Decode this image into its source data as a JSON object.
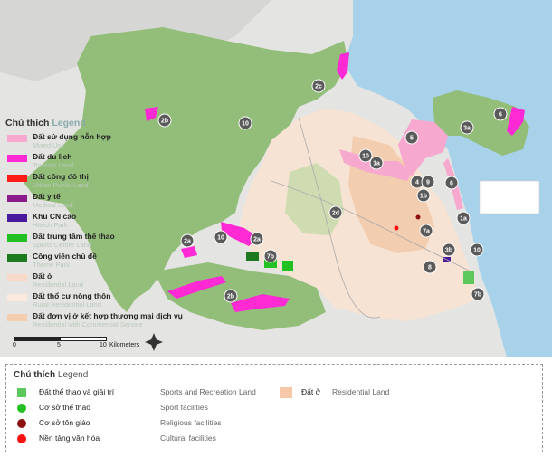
{
  "legend": {
    "title_vi": "Chú thích",
    "title_en": "Legend",
    "items": [
      {
        "vi": "Đất sử dụng hỗn hợp",
        "en": "Mixed Use",
        "color": "#f7a8cf"
      },
      {
        "vi": "Đất du lịch",
        "en": "Tourism Land",
        "color": "#ff2ad4"
      },
      {
        "vi": "Đất công đô thị",
        "en": "Urban Public Land",
        "color": "#ff1a1a"
      },
      {
        "vi": "Đất y tế",
        "en": "Medical Land",
        "color": "#8b1a8b"
      },
      {
        "vi": "Khu CN cao",
        "en": "Hitech Park",
        "color": "#4b1a9c"
      },
      {
        "vi": "Đất trung tâm thể thao",
        "en": "Sports Centre Land",
        "color": "#22c022"
      },
      {
        "vi": "Công viên chủ đề",
        "en": "Theme Park",
        "color": "#1f7a1f"
      },
      {
        "vi": "Đất ở",
        "en": "Residential Land",
        "color": "#f6d9c8"
      },
      {
        "vi": "Đất thổ cư nông thôn",
        "en": "Rural Residential Land",
        "color": "#fbe9dd"
      },
      {
        "vi": "Đất đơn vị ở kết hợp thương mại dịch vụ",
        "en": "Residential with Commercial Service",
        "color": "#f2cdb0"
      }
    ]
  },
  "scale": {
    "labels": [
      "0",
      "5",
      "10"
    ],
    "unit": "Kilometers"
  },
  "zones": {
    "labels": [
      "2c",
      "2b",
      "3a",
      "6",
      "5",
      "10",
      "10",
      "1a",
      "4",
      "9",
      "6",
      "1b",
      "2d",
      "7a",
      "1a",
      "2a",
      "10",
      "2a",
      "7b",
      "3b",
      "10",
      "8",
      "2b",
      "7b"
    ]
  },
  "bottom_legend": {
    "title_vi": "Chú thích",
    "title_en": "Legend",
    "items": [
      {
        "vi": "Đất thể thao và giải trí",
        "en": "Sports and Recreation Land",
        "color": "#5cc85c",
        "shape": "square"
      },
      {
        "vi": "Cơ sở thể thao",
        "en": "Sport facilities",
        "color": "#22c022",
        "shape": "circle"
      },
      {
        "vi": "Cơ sở tôn giáo",
        "en": "Religious facilities",
        "color": "#8b1010",
        "shape": "circle"
      },
      {
        "vi": "Nền tảng văn hóa",
        "en": "Cultural facilities",
        "color": "#ff1010",
        "shape": "circle"
      }
    ],
    "residential": {
      "vi": "Đất ở",
      "en": "Residential Land",
      "color": "#f6c7a8"
    }
  }
}
